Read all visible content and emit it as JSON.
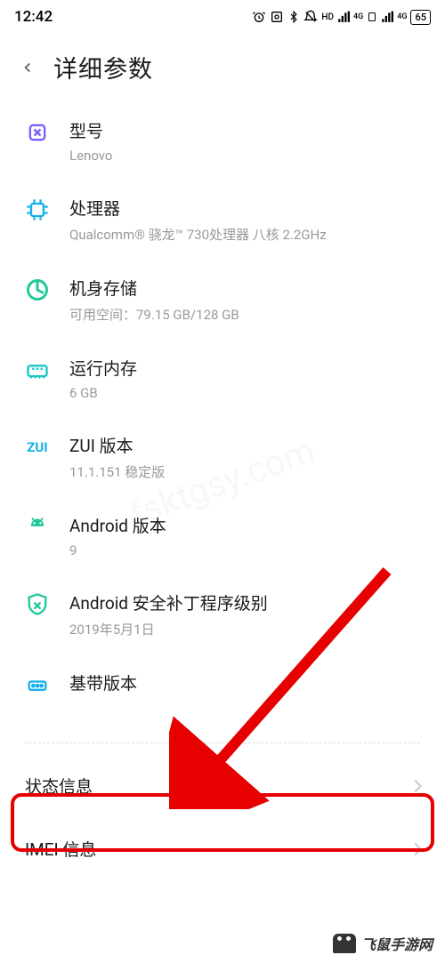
{
  "status_bar": {
    "time": "12:42",
    "hd_label": "HD",
    "net1_label": "4G",
    "net2_label": "4G",
    "battery": "65"
  },
  "header": {
    "title": "详细参数"
  },
  "items": {
    "model": {
      "title": "型号",
      "value": "Lenovo"
    },
    "processor": {
      "title": "处理器",
      "value": "Qualcomm® 骁龙™ 730处理器 八核 2.2GHz"
    },
    "storage": {
      "title": "机身存储",
      "value": "可用空间：79.15 GB/128 GB"
    },
    "ram": {
      "title": "运行内存",
      "value": "6 GB"
    },
    "zui": {
      "title": "ZUI 版本",
      "value": "11.1.151 稳定版",
      "icon_text": "ZUI"
    },
    "android": {
      "title": "Android 版本",
      "value": "9"
    },
    "security_patch": {
      "title": "Android 安全补丁程序级别",
      "value": "2019年5月1日"
    },
    "baseband": {
      "title": "基带版本",
      "value": ""
    }
  },
  "nav": {
    "status_info": "状态信息",
    "imei_info": "IMEI 信息"
  },
  "watermark": "fsktgsy.com",
  "footer": {
    "logo_text": "飞鼠手游网"
  },
  "colors": {
    "icon_purple": "#7c5cff",
    "icon_blue": "#12b0e8",
    "icon_green": "#1fc79a",
    "icon_teal": "#14c8c8",
    "highlight": "#e60000"
  }
}
